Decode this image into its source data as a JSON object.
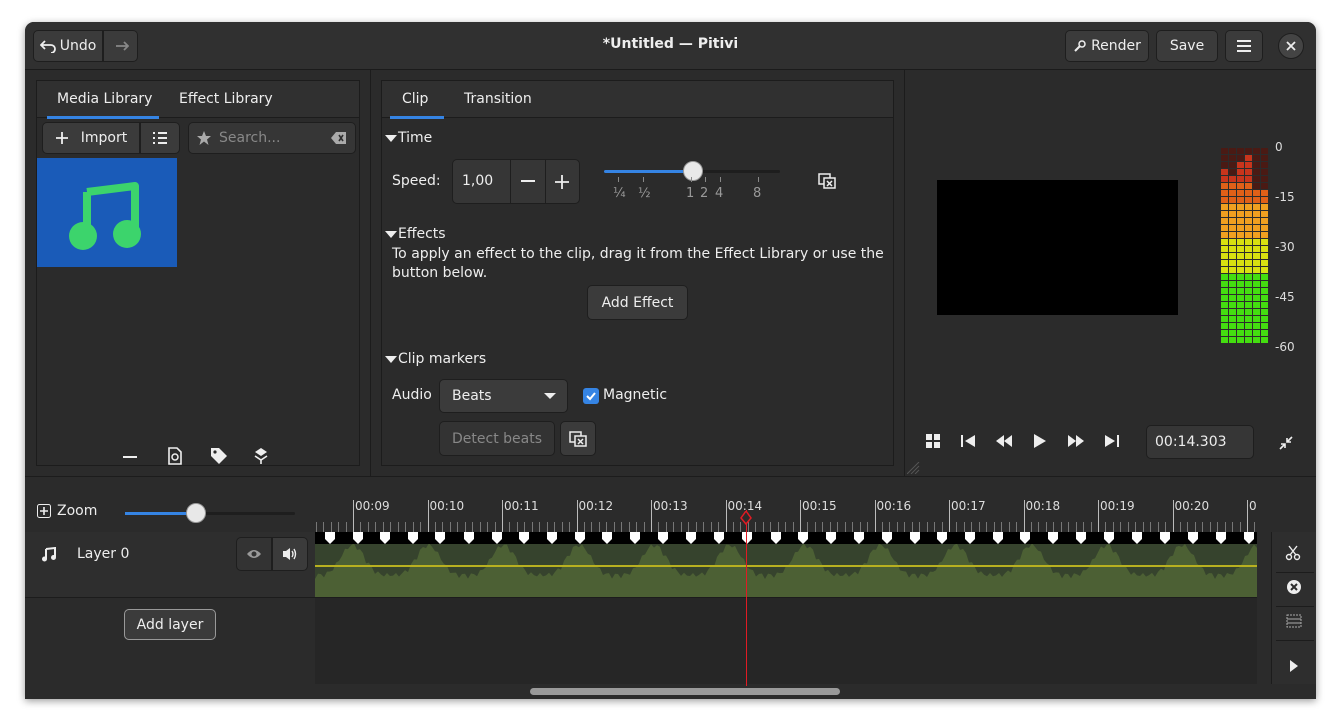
{
  "header": {
    "undo_label": "Undo",
    "title": "*Untitled — Pitivi",
    "render_label": "Render",
    "save_label": "Save"
  },
  "library": {
    "tabs": [
      "Media Library",
      "Effect Library"
    ],
    "import_label": "Import",
    "search_placeholder": "Search..."
  },
  "clip_panel": {
    "tabs": [
      "Clip",
      "Transition"
    ],
    "time_heading": "Time",
    "speed_label": "Speed:",
    "speed_value": "1,00",
    "speed_ticks": [
      "¼",
      "½",
      "1",
      "2",
      "4",
      "8"
    ],
    "effects_heading": "Effects",
    "effects_text": "To apply an effect to the clip, drag it from the Effect Library or use the button below.",
    "add_effect_label": "Add Effect",
    "markers_heading": "Clip markers",
    "audio_label": "Audio",
    "audio_select": "Beats",
    "magnetic_label": "Magnetic",
    "magnetic_checked": true,
    "detect_beats_label": "Detect beats"
  },
  "viewer": {
    "timecode": "00:14.303",
    "meter_labels": [
      "0",
      "-15",
      "-30",
      "-45",
      "-60"
    ]
  },
  "timeline": {
    "zoom_label": "Zoom",
    "layer_name": "Layer 0",
    "add_layer_label": "Add layer",
    "ruler_labels": [
      "00:09",
      "00:10",
      "00:11",
      "00:12",
      "00:13",
      "00:14",
      "00:15",
      "00:16",
      "00:17",
      "00:18",
      "00:19",
      "00:20",
      "0"
    ],
    "playhead_time": "00:14.303"
  },
  "colors": {
    "accent": "#3584e4",
    "media_thumb_bg": "#1a5bb8",
    "music_icon": "#3cd46c",
    "playhead": "#e01b24",
    "clip_bg": "#36432d",
    "waveform": "#4c6034",
    "volume_line": "#b8b020"
  }
}
